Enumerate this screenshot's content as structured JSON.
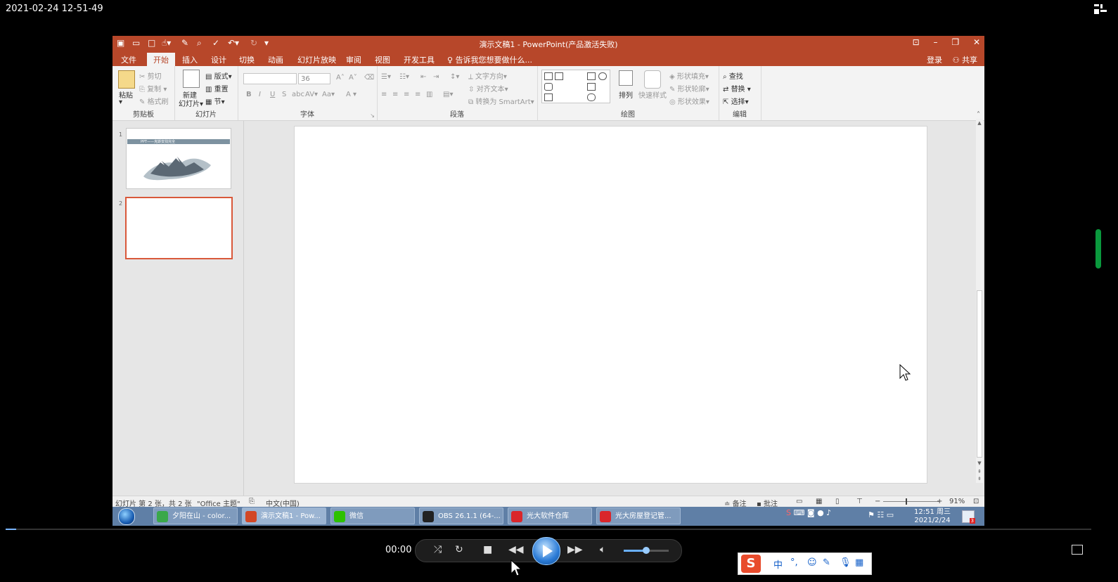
{
  "recording_timestamp": "2021-02-24 12-51-49",
  "powerpoint": {
    "window_title": "演示文稿1 - PowerPoint(产品激活失败)",
    "tabs": [
      "文件",
      "开始",
      "插入",
      "设计",
      "切换",
      "动画",
      "幻灯片放映",
      "审阅",
      "视图",
      "开发工具"
    ],
    "active_tab": "开始",
    "tell_me": "告诉我您想要做什么...",
    "login": "登录",
    "share": "共享",
    "ribbon": {
      "clipboard": {
        "label": "剪贴板",
        "paste": "粘贴",
        "cut": "剪切",
        "copy": "复制",
        "format_painter": "格式刷"
      },
      "slides": {
        "label": "幻灯片",
        "new_slide_line1": "新建",
        "new_slide_line2": "幻灯片",
        "layout": "版式",
        "reset": "重置",
        "section": "节"
      },
      "font": {
        "label": "字体",
        "size": "36",
        "bold": "B",
        "italic": "I",
        "underline": "U",
        "strike": "S",
        "spacing": "abc",
        "case": "Aa",
        "color": "A"
      },
      "paragraph": {
        "label": "段落",
        "text_direction": "文字方向",
        "align_text": "对齐文本",
        "smartart": "转换为 SmartArt"
      },
      "drawing": {
        "label": "绘图",
        "arrange": "排列",
        "quick_styles": "快速样式",
        "shape_fill": "形状填充",
        "shape_outline": "形状轮廓",
        "shape_effects": "形状效果"
      },
      "editing": {
        "label": "编辑",
        "find": "查找",
        "replace": "替换",
        "select": "选择"
      }
    },
    "thumbnails": [
      {
        "number": "1",
        "title_text": "PPT——克斯安找完全"
      },
      {
        "number": "2"
      }
    ],
    "status": {
      "slide_info": "幻灯片 第 2 张，共 2 张",
      "theme": "\"Office 主题\"",
      "language": "中文(中国)",
      "notes": "备注",
      "comments": "批注",
      "zoom": "91%"
    }
  },
  "taskbar": {
    "items": [
      {
        "label": "夕阳在山 - color...",
        "color": "#3aa84a"
      },
      {
        "label": "演示文稿1 - Pow...",
        "color": "#d24726"
      },
      {
        "label": "微信",
        "color": "#2dc100"
      },
      {
        "label": "OBS 26.1.1 (64-...",
        "color": "#222222"
      },
      {
        "label": "光大软件仓库",
        "color": "#d9262b"
      },
      {
        "label": "光大房屋登记管...",
        "color": "#d9262b"
      }
    ],
    "clock_time": "12:51 周三",
    "clock_date": "2021/2/24",
    "notification_count": "3"
  },
  "player": {
    "time": "00:00",
    "volume_fraction": 0.5,
    "progress_fraction": 0.01
  },
  "ime": {
    "logo": "S",
    "mode": "中",
    "punct": "°,"
  }
}
